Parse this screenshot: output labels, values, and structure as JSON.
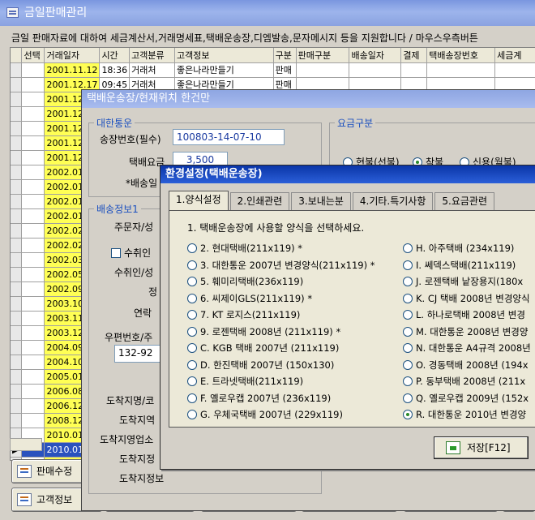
{
  "main": {
    "title": "금일판매관리",
    "info": "금일 판매자료에 대하여 세금계산서,거래명세표,택배운송장,디엠발송,문자메시지 등을 지원합니다 / 마우스우측버튼",
    "columns": [
      "선택",
      "거래일자",
      "시간",
      "고객분류",
      "고객정보",
      "구분",
      "판매구분",
      "배송일자",
      "결제",
      "택배송장번호",
      "세금계"
    ],
    "rows": [
      {
        "date": "2001.11.12",
        "time": "18:36",
        "cat": "거래처",
        "info": "좋은나라만들기",
        "kind": "판매"
      },
      {
        "date": "2001.12.17",
        "time": "09:45",
        "cat": "거래처",
        "info": "좋은나라만들기",
        "kind": "판매"
      },
      {
        "date": "2001.12",
        "time": "",
        "cat": "",
        "info": "",
        "kind": ""
      },
      {
        "date": "2001.12",
        "time": "",
        "cat": "",
        "info": "",
        "kind": ""
      },
      {
        "date": "2001.12",
        "time": "",
        "cat": "",
        "info": "",
        "kind": ""
      },
      {
        "date": "2001.12",
        "time": "",
        "cat": "",
        "info": "",
        "kind": ""
      },
      {
        "date": "2001.12",
        "time": "",
        "cat": "",
        "info": "",
        "kind": ""
      },
      {
        "date": "2002.01",
        "time": "",
        "cat": "",
        "info": "",
        "kind": ""
      },
      {
        "date": "2002.01",
        "time": "",
        "cat": "",
        "info": "",
        "kind": ""
      },
      {
        "date": "2002.01",
        "time": "",
        "cat": "",
        "info": "",
        "kind": ""
      },
      {
        "date": "2002.01",
        "time": "",
        "cat": "",
        "info": "",
        "kind": ""
      },
      {
        "date": "2002.02",
        "time": "",
        "cat": "",
        "info": "",
        "kind": ""
      },
      {
        "date": "2002.02",
        "time": "",
        "cat": "",
        "info": "",
        "kind": ""
      },
      {
        "date": "2002.03",
        "time": "",
        "cat": "",
        "info": "",
        "kind": ""
      },
      {
        "date": "2002.05",
        "time": "",
        "cat": "",
        "info": "",
        "kind": ""
      },
      {
        "date": "2002.09",
        "time": "",
        "cat": "",
        "info": "",
        "kind": ""
      },
      {
        "date": "2003.10",
        "time": "",
        "cat": "",
        "info": "",
        "kind": ""
      },
      {
        "date": "2003.11",
        "time": "",
        "cat": "",
        "info": "",
        "kind": ""
      },
      {
        "date": "2003.12",
        "time": "",
        "cat": "",
        "info": "",
        "kind": ""
      },
      {
        "date": "2004.09",
        "time": "",
        "cat": "",
        "info": "",
        "kind": ""
      },
      {
        "date": "2004.10",
        "time": "",
        "cat": "",
        "info": "",
        "kind": ""
      },
      {
        "date": "2005.01",
        "time": "",
        "cat": "",
        "info": "",
        "kind": ""
      },
      {
        "date": "2006.08",
        "time": "",
        "cat": "",
        "info": "",
        "kind": ""
      },
      {
        "date": "2006.12",
        "time": "",
        "cat": "",
        "info": "",
        "kind": ""
      },
      {
        "date": "2008.12",
        "time": "",
        "cat": "",
        "info": "",
        "kind": ""
      },
      {
        "date": "2010.01",
        "time": "",
        "cat": "",
        "info": "",
        "kind": ""
      },
      {
        "date": "2010.01",
        "time": "",
        "cat": "",
        "info": "",
        "kind": ""
      },
      {
        "date": "2010.01",
        "time": "",
        "cat": "",
        "info": "",
        "kind": ""
      }
    ],
    "buttons": {
      "sales_edit": "판매수정",
      "customer_info": "고객정보"
    }
  },
  "shipping": {
    "title": "택배운송장/현재위치 한건만",
    "carrier_legend": "대한통운",
    "fee_legend": "요금구분",
    "invoice_label": "송장번호(필수)",
    "invoice_value": "100803-14-07-10",
    "fee_label": "택배요금",
    "fee_value": "3,500",
    "delivery_label": "*배송일",
    "fee_options": [
      "현불(선불)",
      "착불",
      "신용(월불)"
    ],
    "info_legend": "배송정보1",
    "orderer_label": "주문자/성",
    "receiver_check_label": "수취인",
    "receiver_label": "수취인/성",
    "phone_label": "정",
    "contact_label": "연락",
    "zip_label": "우편번호/주",
    "zip_value": "132-92",
    "dest_name_label": "도착지명/코",
    "dest_label": "도착지역",
    "dest_office_label": "도착지영업소",
    "dest_box_label": "도착지정",
    "dest_info_label": "도착지정보"
  },
  "settings": {
    "title": "환경설정(택배운송장)",
    "tabs": [
      "1.양식설정",
      "2.인쇄관련",
      "3.보내는분",
      "4.기타.특기사항",
      "5.요금관련"
    ],
    "instruction": "1. 택배운송장에 사용할 양식을 선택하세요.",
    "left_options": [
      "2. 현대택배(211x119) *",
      "3. 대한통운 2007년 변경양식(211x119) *",
      "5. 훼미리택배(236x119)",
      "6. 씨제이GLS(211x119) *",
      "7. KT 로지스(211x119)",
      "9. 로젠택배 2008년 (211x119) *",
      "C. KGB 택배 2007년 (211x119)",
      "D. 한진택배 2007년 (150x130)",
      "E. 트라넷택배(211x119)",
      "F. 옐로우캡 2007년 (236x119)",
      "G. 우체국택배 2007년 (229x119)"
    ],
    "right_options": [
      "H. 아주택배 (234x119)",
      "I. 쎄덱스택배(211x119)",
      "J. 로젠택배 낱장용지(180x",
      "K. CJ 택배 2008년 변경양식",
      "L. 하나로택배 2008년 변경",
      "M. 대한통운 2008년 변경양",
      "N. 대한통운 A4규격 2008년",
      "O. 경동택배 2008년 (194x",
      "P. 동부택배 2008년 (211x",
      "Q. 옐로우캡 2009년 (152x",
      "R. 대한통운 2010년 변경양"
    ],
    "selected_option": "R. 대한통운 2010년 변경양",
    "save_button": "저장[F12]"
  }
}
